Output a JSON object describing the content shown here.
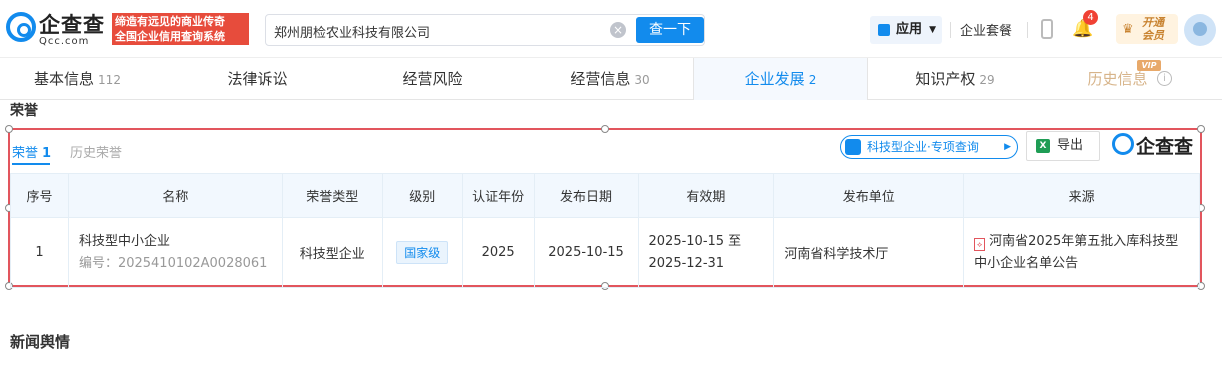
{
  "header": {
    "logo_text": "企查查",
    "logo_sub": "Qcc.com",
    "slogan_line1": "缔造有远见的商业传奇",
    "slogan_line2": "全国企业信用查询系统",
    "search_value": "郑州朋检农业科技有限公司",
    "search_button": "查一下",
    "apps_label": "应用",
    "package_label": "企业套餐",
    "notification_count": "4",
    "vip_line1": "开通",
    "vip_line2": "会员"
  },
  "tabs": [
    {
      "label": "基本信息",
      "count": "112"
    },
    {
      "label": "法律诉讼",
      "count": ""
    },
    {
      "label": "经营风险",
      "count": ""
    },
    {
      "label": "经营信息",
      "count": "30"
    },
    {
      "label": "企业发展",
      "count": "2"
    },
    {
      "label": "知识产权",
      "count": "29"
    },
    {
      "label": "历史信息",
      "count": ""
    }
  ],
  "vip_tag": "VIP",
  "section": {
    "title": "荣誉",
    "next_title": "新闻舆情"
  },
  "honors": {
    "subtabs": [
      {
        "label": "荣誉",
        "count": "1"
      },
      {
        "label": "历史荣誉",
        "count": ""
      }
    ],
    "query_button": "科技型企业·专项查询",
    "export_button": "导出",
    "brand": "企查查",
    "columns": [
      "序号",
      "名称",
      "荣誉类型",
      "级别",
      "认证年份",
      "发布日期",
      "有效期",
      "发布单位",
      "来源"
    ],
    "rows": [
      {
        "index": "1",
        "name": "科技型中小企业",
        "code": "编号：2025410102A0028061",
        "type": "科技型企业",
        "level": "国家级",
        "year": "2025",
        "publish_date": "2025-10-15",
        "valid_from": "2025-10-15 至",
        "valid_to": "2025-12-31",
        "unit": "河南省科学技术厅",
        "source": "河南省2025年第五批入库科技型中小企业名单公告"
      }
    ]
  }
}
